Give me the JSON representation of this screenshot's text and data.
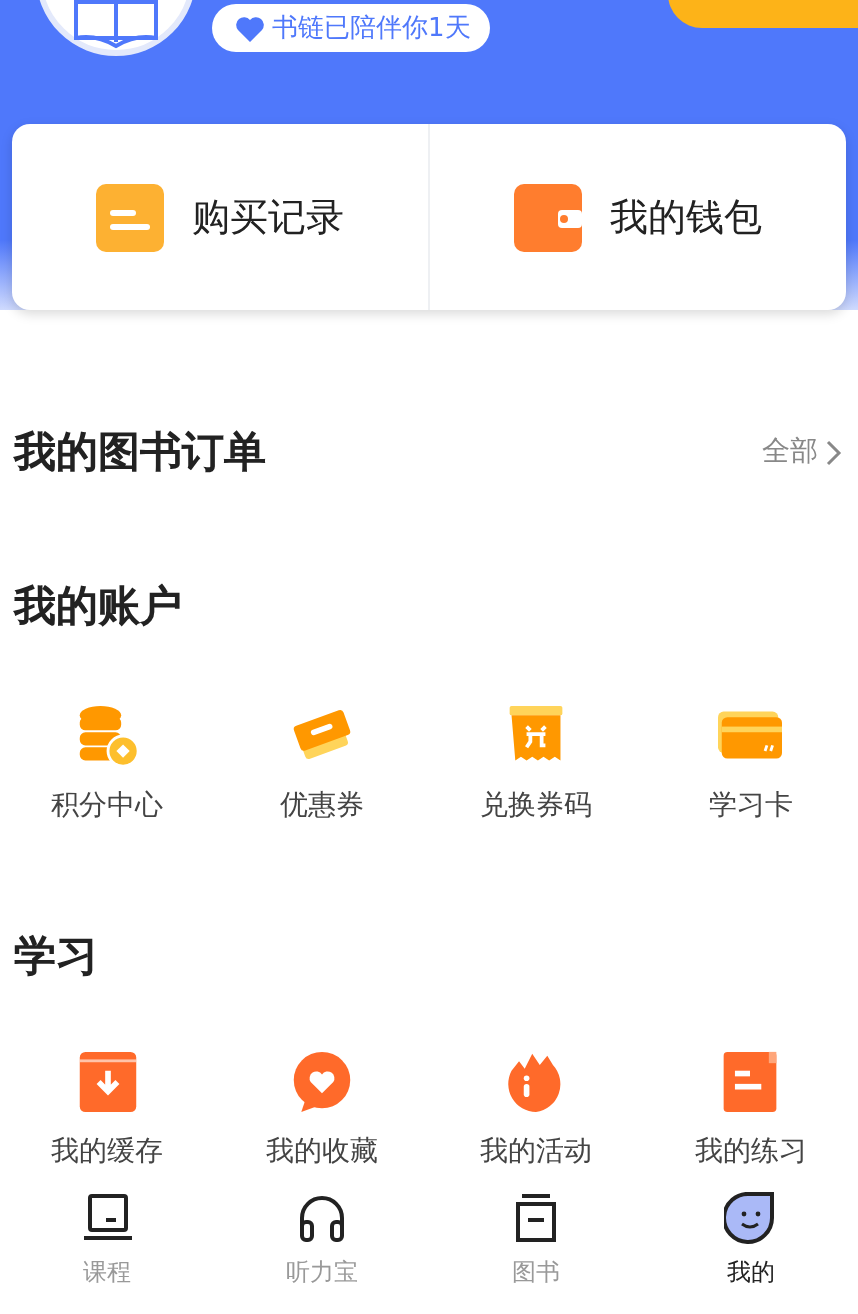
{
  "profile": {
    "badge": "书链已陪伴你1天"
  },
  "quick_links": [
    {
      "label": "购买记录",
      "kind": "records"
    },
    {
      "label": "我的钱包",
      "kind": "wallet"
    }
  ],
  "orders": {
    "title": "我的图书订单",
    "link": "全部"
  },
  "sections": [
    {
      "title": "我的账户",
      "items": [
        {
          "label": "积分中心",
          "kind": "coins"
        },
        {
          "label": "优惠券",
          "kind": "coupon"
        },
        {
          "label": "兑换券码",
          "kind": "redeem"
        },
        {
          "label": "学习卡",
          "kind": "card"
        }
      ]
    },
    {
      "title": "学习",
      "items": [
        {
          "label": "我的缓存",
          "kind": "download"
        },
        {
          "label": "我的收藏",
          "kind": "favorite"
        },
        {
          "label": "我的活动",
          "kind": "flame"
        },
        {
          "label": "我的练习",
          "kind": "exercise"
        }
      ]
    }
  ],
  "tabs": [
    {
      "label": "课程",
      "kind": "course",
      "selected": false
    },
    {
      "label": "听力宝",
      "kind": "headphones",
      "selected": false
    },
    {
      "label": "图书",
      "kind": "book",
      "selected": false
    },
    {
      "label": "我的",
      "kind": "me",
      "selected": true
    }
  ]
}
